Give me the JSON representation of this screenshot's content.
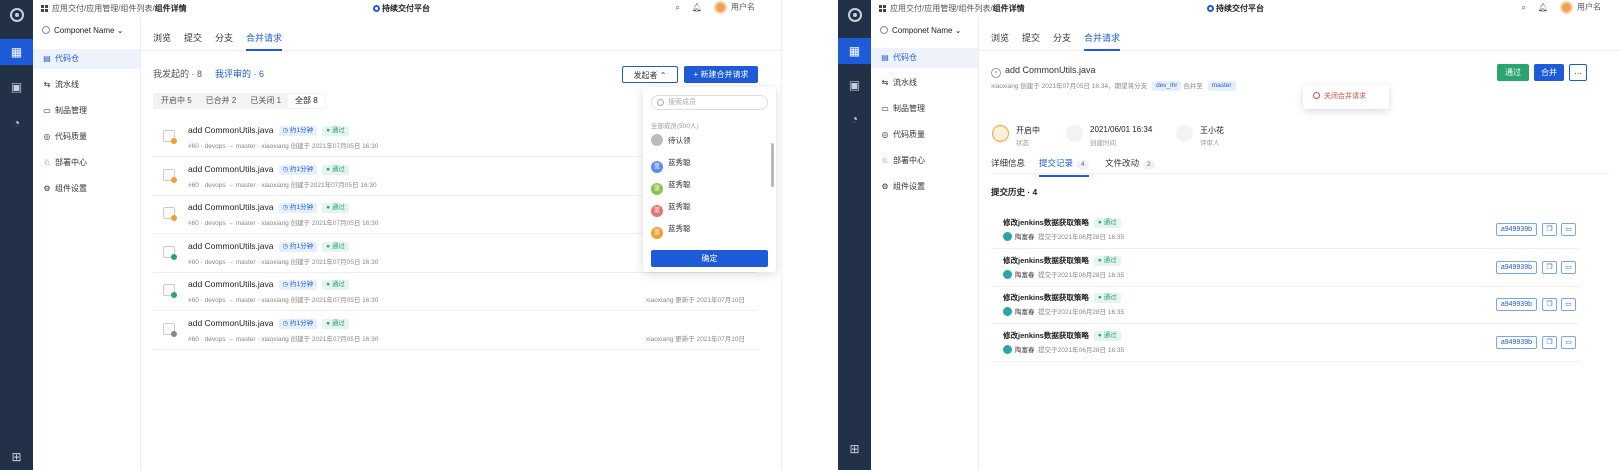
{
  "topbar": {
    "breadcrumb_prefix": "应用交付/应用管理/组件列表/",
    "breadcrumb_current": "组件详情",
    "platform": "持续交付平台",
    "username": "用户名",
    "search_icon": "search-icon",
    "bell_icon": "bell-icon"
  },
  "sidebar": {
    "project": "Componet Name",
    "items": [
      {
        "label": "代码仓",
        "icon": "repo-icon"
      },
      {
        "label": "流水线",
        "icon": "pipeline-icon"
      },
      {
        "label": "制品管理",
        "icon": "artifact-icon"
      },
      {
        "label": "代码质量",
        "icon": "quality-icon"
      },
      {
        "label": "部署中心",
        "icon": "deploy-icon"
      },
      {
        "label": "组件设置",
        "icon": "gear-icon"
      }
    ]
  },
  "tabs": [
    "浏览",
    "提交",
    "分支",
    "合并请求"
  ],
  "left": {
    "filter_mine": "我发起的 · 8",
    "filter_review": "我评审的 · 6",
    "initiator_btn": "发起者",
    "new_btn": "+ 新建合并请求",
    "segments": [
      "开启中 5",
      "已合并 2",
      "已关闭 1",
      "全部 8"
    ],
    "rows": [
      {
        "title": "add CommonUtils.java",
        "time_tag": "约1分钟",
        "status": "通过",
        "meta": "#60 · devops → master · xiaoxiang 创建于 2021年07月05日 16:30",
        "updated": "",
        "dot": "#f0a030"
      },
      {
        "title": "add CommonUtils.java",
        "time_tag": "约1分钟",
        "status": "通过",
        "meta": "#60 · devops → master · xiaoxiang 创建于2021年07月05日 16:30",
        "updated": "",
        "dot": "#f0a030"
      },
      {
        "title": "add CommonUtils.java",
        "time_tag": "约1分钟",
        "status": "通过",
        "meta": "#60 · devops → master · xiaoxiang 创建于 2021年07月05日 16:30",
        "updated": "",
        "dot": "#f0a030"
      },
      {
        "title": "add CommonUtils.java",
        "time_tag": "约1分钟",
        "status": "通过",
        "meta": "#60 · devops → master · xiaoxiang 创建于 2021年07月05日 16:30",
        "updated": "",
        "dot": "#2ba471"
      },
      {
        "title": "add CommonUtils.java",
        "time_tag": "约1分钟",
        "status": "通过",
        "meta": "#60 · devops → master · xiaoxiang 创建于 2021年07月05日 16:30",
        "updated": "xiaoxiang 更新于 2021年07月10日",
        "dot": "#2ba471"
      },
      {
        "title": "add CommonUtils.java",
        "time_tag": "约1分钟",
        "status": "通过",
        "meta": "#60 · devops → master · xiaoxiang 创建于 2021年07月05日 16:30",
        "updated": "xiaoxiang 更新于 2021年07月10日",
        "dot": "#888888"
      }
    ],
    "dropdown": {
      "search_placeholder": "搜索成员",
      "count": "全部成员(500人)",
      "items": [
        {
          "name": "待认领",
          "color": "#bbbbbb",
          "glyph": ""
        },
        {
          "name": "蓝秀聪",
          "color": "#5b8def",
          "glyph": "蓝"
        },
        {
          "name": "蓝秀聪",
          "color": "#8bc34a",
          "glyph": "蓝"
        },
        {
          "name": "蓝秀聪",
          "color": "#e57373",
          "glyph": "蓝"
        },
        {
          "name": "蓝秀聪",
          "color": "#f0a030",
          "glyph": "蓝"
        }
      ],
      "confirm": "确定"
    }
  },
  "right": {
    "title": "add CommonUtils.java",
    "meta_prefix": "xiaoxiang 创建于 2021年07月05日 16:34，期望将分支",
    "branch_from": "dev_lhr",
    "meta_mid": "合并至",
    "branch_to": "master",
    "approve_btn": "通过",
    "merge_btn": "合并",
    "close_mr": "关闭合并请求",
    "status": [
      {
        "value": "开启中",
        "label": "状态",
        "color": "#f5a623"
      },
      {
        "value": "2021/06/01 16:34",
        "label": "创建时间",
        "color": "#888888"
      },
      {
        "value": "王小花",
        "label": "评审人",
        "color": "#888888"
      }
    ],
    "content_tabs": [
      {
        "label": "详细信息",
        "count": ""
      },
      {
        "label": "提交记录",
        "count": "4"
      },
      {
        "label": "文件改动",
        "count": "2"
      }
    ],
    "history_title": "提交历史 · 4",
    "commits": [
      {
        "title": "修改jenkins数据获取策略",
        "status": "通过",
        "author": "陶富春",
        "time": "提交于2021年06月28日 16:35",
        "hash": "a949939b"
      },
      {
        "title": "修改jenkins数据获取策略",
        "status": "通过",
        "author": "陶富春",
        "time": "提交于2021年06月28日 16:35",
        "hash": "a949939b"
      },
      {
        "title": "修改jenkins数据获取策略",
        "status": "通过",
        "author": "陶富春",
        "time": "提交于2021年06月28日 16:35",
        "hash": "a949939b"
      },
      {
        "title": "修改jenkins数据获取策略",
        "status": "通过",
        "author": "陶富春",
        "time": "提交于2021年06月28日 16:35",
        "hash": "a949939b"
      }
    ]
  }
}
